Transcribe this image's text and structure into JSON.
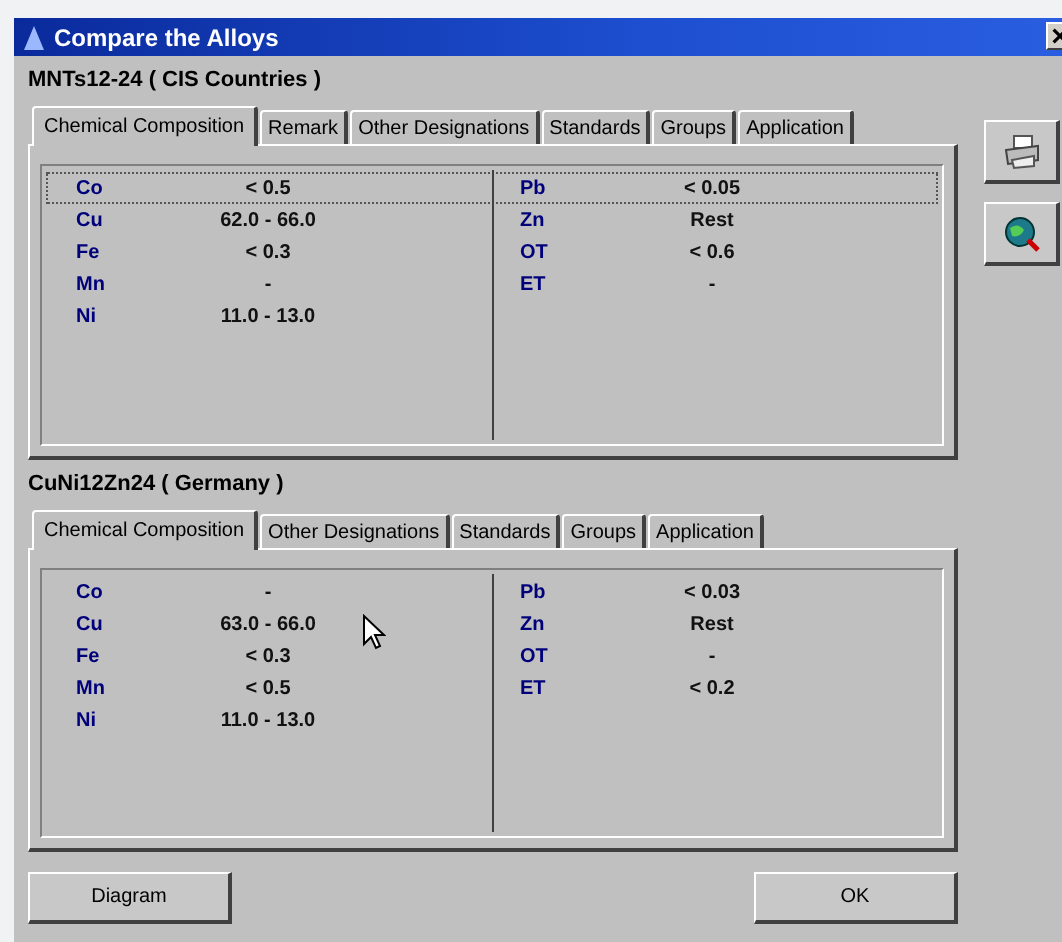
{
  "window": {
    "title": "Compare the Alloys"
  },
  "alloys": [
    {
      "heading": "MNTs12-24 ( CIS Countries )",
      "tabs": [
        {
          "label": "Chemical Composition",
          "selected": true
        },
        {
          "label": "Remark",
          "selected": false
        },
        {
          "label": "Other Designations",
          "selected": false
        },
        {
          "label": "Standards",
          "selected": false
        },
        {
          "label": "Groups",
          "selected": false
        },
        {
          "label": "Application",
          "selected": false
        }
      ],
      "rows": [
        {
          "left": {
            "element": "Co",
            "value": "< 0.5"
          },
          "right": {
            "element": "Pb",
            "value": "< 0.05"
          },
          "selected": true
        },
        {
          "left": {
            "element": "Cu",
            "value": "62.0 - 66.0"
          },
          "right": {
            "element": "Zn",
            "value": "Rest"
          },
          "selected": false
        },
        {
          "left": {
            "element": "Fe",
            "value": "< 0.3"
          },
          "right": {
            "element": "OT",
            "value": "< 0.6"
          },
          "selected": false
        },
        {
          "left": {
            "element": "Mn",
            "value": "-"
          },
          "right": {
            "element": "ET",
            "value": "-"
          },
          "selected": false
        },
        {
          "left": {
            "element": "Ni",
            "value": "11.0 - 13.0"
          },
          "selected": false
        }
      ]
    },
    {
      "heading": "CuNi12Zn24 ( Germany )",
      "tabs": [
        {
          "label": "Chemical Composition",
          "selected": true
        },
        {
          "label": "Other Designations",
          "selected": false
        },
        {
          "label": "Standards",
          "selected": false
        },
        {
          "label": "Groups",
          "selected": false
        },
        {
          "label": "Application",
          "selected": false
        }
      ],
      "rows": [
        {
          "left": {
            "element": "Co",
            "value": "-"
          },
          "right": {
            "element": "Pb",
            "value": "< 0.03"
          },
          "selected": false
        },
        {
          "left": {
            "element": "Cu",
            "value": "63.0 - 66.0"
          },
          "right": {
            "element": "Zn",
            "value": "Rest"
          },
          "selected": false
        },
        {
          "left": {
            "element": "Fe",
            "value": "< 0.3"
          },
          "right": {
            "element": "OT",
            "value": "-"
          },
          "selected": false
        },
        {
          "left": {
            "element": "Mn",
            "value": "< 0.5"
          },
          "right": {
            "element": "ET",
            "value": "< 0.2"
          },
          "selected": false
        },
        {
          "left": {
            "element": "Ni",
            "value": "11.0 - 13.0"
          },
          "selected": false
        }
      ]
    }
  ],
  "buttons": {
    "left": "Diagram",
    "right": "OK"
  }
}
